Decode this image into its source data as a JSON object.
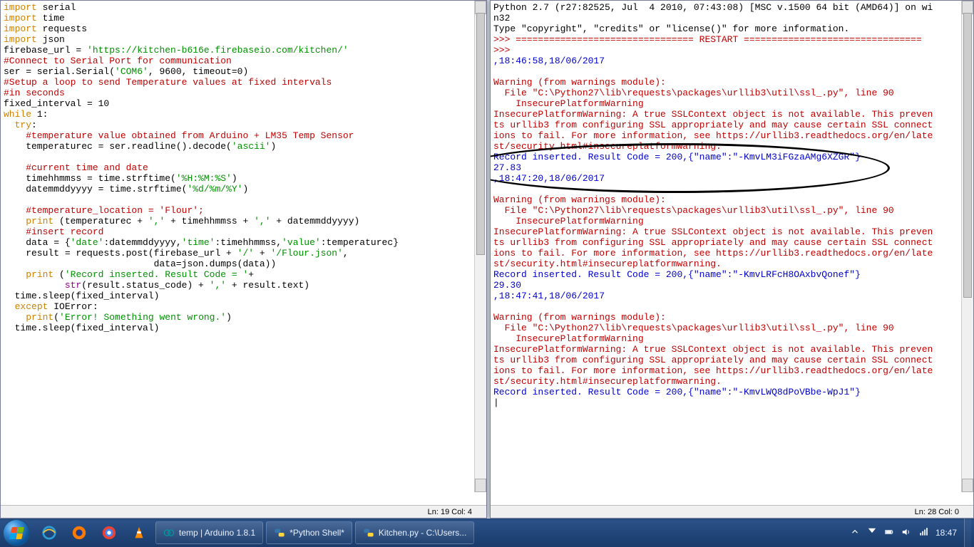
{
  "left": {
    "code": {
      "l1a": "import",
      "l1b": " serial",
      "l2a": "import",
      "l2b": " time",
      "l3a": "import",
      "l3b": " requests",
      "l4a": "import",
      "l4b": " json",
      "l5a": "firebase_url = ",
      "l5b": "'https://kitchen-b616e.firebaseio.com/kitchen/'",
      "l6": "#Connect to Serial Port for communication",
      "l7a": "ser = serial.Serial(",
      "l7b": "'COM6'",
      "l7c": ", 9600, timeout=0)",
      "l8": "#Setup a loop to send Temperature values at fixed intervals",
      "l9": "#in seconds",
      "l10": "fixed_interval = 10",
      "l11a": "while",
      "l11b": " 1:",
      "l12a": "  ",
      "l12b": "try",
      "l12c": ":",
      "l13": "    #temperature value obtained from Arduino + LM35 Temp Sensor",
      "l14a": "    temperaturec = ser.readline().decode(",
      "l14b": "'ascii'",
      "l14c": ")",
      "l15": "",
      "l16": "    #current time and date",
      "l17a": "    timehhmmss = time.strftime(",
      "l17b": "'%H:%M:%S'",
      "l17c": ")",
      "l18a": "    datemmddyyyy = time.strftime(",
      "l18b": "'%d/%m/%Y'",
      "l18c": ")",
      "l19": "",
      "l20": "    #temperature_location = 'Flour';",
      "l21a": "    ",
      "l21b": "print",
      "l21c": " (temperaturec + ",
      "l21d": "','",
      "l21e": " + timehhmmss + ",
      "l21f": "','",
      "l21g": " + datemmddyyyy)",
      "l22": "    #insert record",
      "l23a": "    data = {",
      "l23b": "'date'",
      "l23c": ":datemmddyyyy,",
      "l23d": "'time'",
      "l23e": ":timehhmmss,",
      "l23f": "'value'",
      "l23g": ":temperaturec}",
      "l24a": "    result = requests.post(firebase_url + ",
      "l24b": "'/'",
      "l24c": " + ",
      "l24d": "'/Flour.json'",
      "l24e": ",",
      "l25a": "                           data=json.dumps(data))",
      "l26a": "    ",
      "l26b": "print",
      "l26c": " (",
      "l26d": "'Record inserted. Result Code = '",
      "l26e": "+",
      "l27a": "           ",
      "l27b": "str",
      "l27c": "(result.status_code) + ",
      "l27d": "','",
      "l27e": " + result.text)",
      "l28": "  time.sleep(fixed_interval)",
      "l29a": "  ",
      "l29b": "except",
      "l29c": " IOError:",
      "l30a": "    ",
      "l30b": "print",
      "l30c": "(",
      "l30d": "'Error! Something went wrong.'",
      "l30e": ")",
      "l31": "  time.sleep(fixed_interval)"
    },
    "status": "Ln: 19 Col: 4"
  },
  "right": {
    "out": {
      "h1": "Python 2.7 (r27:82525, Jul  4 2010, 07:43:08) [MSC v.1500 64 bit (AMD64)] on wi",
      "h2": "n32",
      "h3": "Type \"copyright\", \"credits\" or \"license()\" for more information.",
      "r1": ">>> ================================ RESTART ================================",
      "r2": ">>> ",
      "t1": ",18:46:58,18/06/2017",
      "w1": "Warning (from warnings module):",
      "w2": "  File \"C:\\Python27\\lib\\requests\\packages\\urllib3\\util\\ssl_.py\", line 90",
      "w3": "    InsecurePlatformWarning",
      "w4": "InsecurePlatformWarning: A true SSLContext object is not available. This preven",
      "w5": "ts urllib3 from configuring SSL appropriately and may cause certain SSL connect",
      "w6a": "ions to fail. For more information, see https://urllib3.readthedocs.org/en/late",
      "w6b": "st/security.html#insecureplatformwarning.",
      "ins1": "Record inserted. Result Code = 200,{\"name\":\"-KmvLM3iFGzaAMg6XZGR\"}",
      "v1": "27.83",
      "t2": ",18:47:20,18/06/2017",
      "ins2": "Record inserted. Result Code = 200,{\"name\":\"-KmvLRFcH8OAxbvQonef\"}",
      "v2": "29.30",
      "t3": ",18:47:41,18/06/2017",
      "ins3": "Record inserted. Result Code = 200,{\"name\":\"-KmvLWQ8dPoVBbe-WpJ1\"}"
    },
    "status": "Ln: 28 Col: 0"
  },
  "taskbar": {
    "items": [
      {
        "label": "temp | Arduino 1.8.1",
        "icon": "arduino"
      },
      {
        "label": "*Python Shell*",
        "icon": "python"
      },
      {
        "label": "Kitchen.py - C:\\Users...",
        "icon": "python"
      }
    ],
    "clock": "18:47"
  }
}
